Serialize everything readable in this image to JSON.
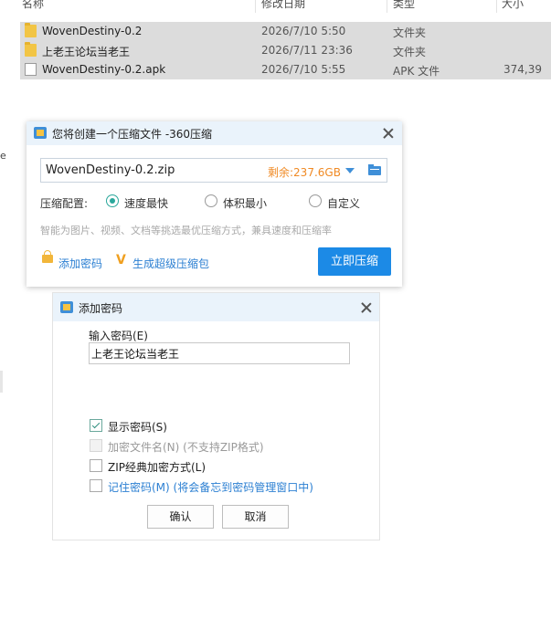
{
  "explorer": {
    "columns": {
      "name": "名称",
      "date": "修改日期",
      "type": "类型",
      "size": "大小"
    },
    "rows": [
      {
        "icon": "folder-icon",
        "name": "WovenDestiny-0.2",
        "date": "2026/7/10 5:50",
        "type": "文件夹",
        "size": ""
      },
      {
        "icon": "folder-icon",
        "name": "上老王论坛当老王",
        "date": "2026/7/11 23:36",
        "type": "文件夹",
        "size": ""
      },
      {
        "icon": "file-icon",
        "name": "WovenDestiny-0.2.apk",
        "date": "2026/7/10 5:55",
        "type": "APK 文件",
        "size": "374,39"
      }
    ],
    "left_fragment": "e"
  },
  "compress_dialog": {
    "title": "您将创建一个压缩文件 -360压缩",
    "filename": "WovenDestiny-0.2.zip",
    "free_space": "剩余:237.6GB",
    "mode_label": "压缩配置:",
    "modes": [
      {
        "label": "速度最快",
        "selected": true
      },
      {
        "label": "体积最小",
        "selected": false
      },
      {
        "label": "自定义",
        "selected": false
      }
    ],
    "hint": "智能为图片、视频、文档等挑选最优压缩方式，兼具速度和压缩率",
    "add_password": "添加密码",
    "super_package": "生成超级压缩包",
    "compress_now": "立即压缩",
    "accent_color": "#1c8ae6"
  },
  "password_dialog": {
    "title": "添加密码",
    "input_label": "输入密码(E)",
    "password_value": "上老王论坛当老王",
    "options": [
      {
        "label": "显示密码(S)",
        "checked": true,
        "disabled": false
      },
      {
        "label": "加密文件名(N) (不支持ZIP格式)",
        "checked": false,
        "disabled": true
      },
      {
        "label": "ZIP经典加密方式(L)",
        "checked": false,
        "disabled": false
      },
      {
        "label": "记住密码(M) (将会备忘到密码管理窗口中)",
        "checked": false,
        "disabled": false
      }
    ],
    "ok": "确认",
    "cancel": "取消"
  }
}
